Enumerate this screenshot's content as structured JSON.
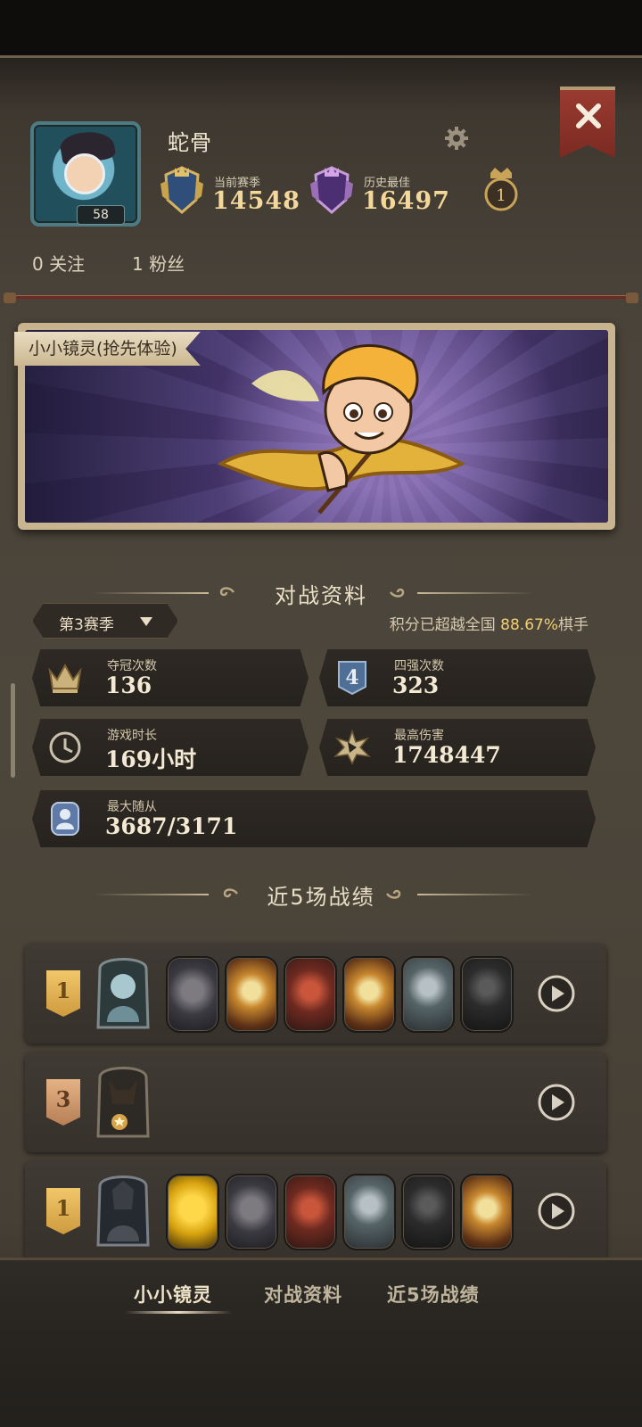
{
  "profile": {
    "name": "蛇骨",
    "level": "58",
    "current_season_label": "当前赛季",
    "current_season_score": "14548",
    "best_label": "历史最佳",
    "best_score": "16497",
    "medal_rank": "1",
    "follows": "0 关注",
    "fans": "1 粉丝"
  },
  "showcase": {
    "hero_name": "小小镜灵(抢先体验)"
  },
  "battle": {
    "title": "对战资料",
    "season": "第3赛季",
    "rank_prefix": "积分已超越全国",
    "rank_pct": "88.67%",
    "rank_suffix": "棋手",
    "stats": [
      {
        "label": "夺冠次数",
        "value": "136",
        "icon": "crown-icon"
      },
      {
        "label": "四强次数",
        "value": "323",
        "icon": "top4-icon"
      },
      {
        "label": "游戏时长",
        "value": "169小时",
        "icon": "clock-icon"
      },
      {
        "label": "最高伤害",
        "value": "1748447",
        "icon": "damage-icon"
      },
      {
        "label": "最大随从",
        "value": "3687/3171",
        "icon": "minion-icon"
      }
    ]
  },
  "recent": {
    "title": "近5场战绩",
    "matches": [
      {
        "place": "1",
        "units": [
          "gray",
          "gold",
          "red",
          "gold",
          "beast",
          "dark"
        ]
      },
      {
        "place": "3",
        "units": []
      },
      {
        "place": "1",
        "units": [
          "yellow",
          "gray",
          "red",
          "beast",
          "dark",
          "gold"
        ]
      }
    ]
  },
  "tabs": [
    "小小镜灵",
    "对战资料",
    "近5场战绩"
  ],
  "colors": {
    "accent": "#f2cf72",
    "close": "#9a3b30"
  }
}
